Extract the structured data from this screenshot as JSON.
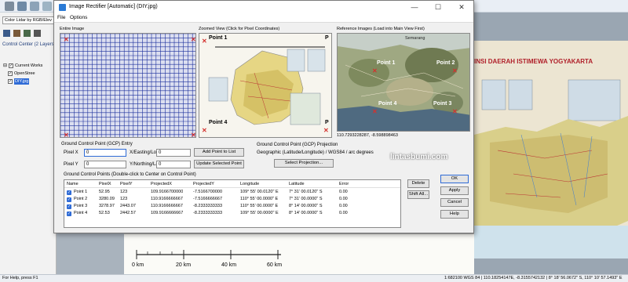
{
  "background_app": {
    "layer_dropdown": "Color Lidar by RGB/Elev",
    "control_center_title": "Control Center (2 Layers)",
    "tree": [
      "Current Works",
      "OpenStree",
      "DIY.jpg"
    ],
    "map_title": "INSI DAERAH ISTIMEWA YOGYAKARTA",
    "scale_labels": [
      "0 km",
      "20 km",
      "40 km",
      "60 km"
    ],
    "status_left": "For Help, press F1",
    "status_right": "1:682100  WGS 84 | 110.18254147E, -8.3155742132 |  8° 18' 56.0672\" S, 110° 10' 57.1493\" E"
  },
  "dialog": {
    "title": "Image Rectifier [Automatic] (DIY.jpg)",
    "window_buttons": [
      "—",
      "☐",
      "✕"
    ],
    "menu": [
      "File",
      "Options"
    ],
    "entire_image_label": "Entire Image",
    "zoomed_view_label": "Zoomed View (Click for Pixel Coordinates)",
    "reference_label": "Reference Images (Load into Main View First)",
    "reference_places": [
      "Semarang",
      "Point 1",
      "Point 2",
      "Point 4",
      "Point 3"
    ],
    "zoomed_points": [
      "Point 1",
      "Point 4",
      "P",
      "P"
    ],
    "reference_coords": "110.7293228287, -8.598898463",
    "watermark": "lintasbumi.com"
  },
  "gcp_entry": {
    "title": "Ground Control Point (GCP) Entry",
    "pixel_x_label": "Pixel X",
    "pixel_x_value": "0",
    "pixel_y_label": "Pixel Y",
    "pixel_y_value": "0",
    "easting_label": "X/Easting/Lon",
    "easting_value": "0",
    "northing_label": "Y/Northing/Lat",
    "northing_value": "0",
    "add_button": "Add Point to List",
    "update_button": "Update Selected Point"
  },
  "projection": {
    "title": "Ground Control Point (GCP) Projection",
    "value": "Geographic (Latitude/Longitude) / WGS84 / arc degrees",
    "select_button": "Select Projection..."
  },
  "gcp_table": {
    "title": "Ground Control Points (Double-click to Center on Control Point)",
    "columns": [
      "Name",
      "PixelX",
      "PixelY",
      "ProjectedX",
      "ProjectedY",
      "Longitude",
      "Latitude",
      "Error"
    ],
    "rows": [
      [
        "Point 1",
        "52.95",
        "123",
        "109.9166700000",
        "-7.5166700000",
        "109° 55' 00.0120\" E",
        "7° 31' 00.0120\" S",
        "0.00"
      ],
      [
        "Point 2",
        "3280.09",
        "123",
        "110.9166666667",
        "-7.5166666667",
        "110° 55' 00.0000\" E",
        "7° 31' 00.0000\" S",
        "0.00"
      ],
      [
        "Point 3",
        "3278.97",
        "2443.07",
        "110.9166666667",
        "-8.2333333333",
        "110° 55' 00.0000\" E",
        "8° 14' 00.0000\" S",
        "0.00"
      ],
      [
        "Point 4",
        "52.53",
        "2442.57",
        "109.9166666667",
        "-8.2333333333",
        "109° 55' 00.0000\" E",
        "8° 14' 00.0000\" S",
        "0.00"
      ]
    ]
  },
  "side_buttons": {
    "delete": "Delete",
    "shift_all": "Shift All...",
    "ok": "OK",
    "apply": "Apply",
    "cancel": "Cancel",
    "help": "Help"
  },
  "colors": {
    "accent": "#2f6bd6",
    "marker_red": "#d4312e",
    "grid_blue": "#1b2f9c"
  }
}
